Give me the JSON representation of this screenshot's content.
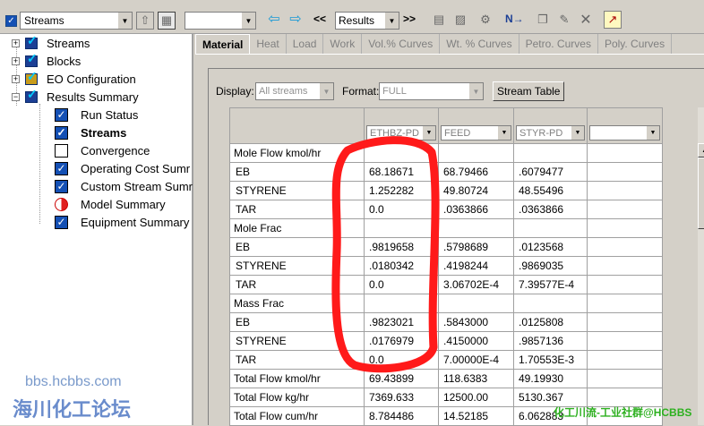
{
  "toolbar": {
    "stream_combo": "Streams",
    "nav_prev": "<<",
    "results_combo": "Results",
    "nav_next": ">>",
    "n_arrow": "N→"
  },
  "tree": {
    "top_items": [
      {
        "label": "Streams"
      },
      {
        "label": "Blocks"
      },
      {
        "label": "EO Configuration"
      },
      {
        "label": "Results Summary"
      }
    ],
    "children": [
      {
        "label": "Run Status",
        "checked": true
      },
      {
        "label": "Streams",
        "checked": true,
        "bold": true
      },
      {
        "label": "Convergence",
        "checked": false
      },
      {
        "label": "Operating Cost Sumr",
        "checked": true
      },
      {
        "label": "Custom Stream Sumr",
        "checked": true
      },
      {
        "label": "Model Summary",
        "checked": false
      },
      {
        "label": "Equipment Summary",
        "checked": true
      }
    ]
  },
  "tabs": [
    "Material",
    "Heat",
    "Load",
    "Work",
    "Vol.% Curves",
    "Wt. % Curves",
    "Petro. Curves",
    "Poly. Curves"
  ],
  "controls": {
    "display_label": "Display:",
    "display_value": "All streams",
    "format_label": "Format:",
    "format_value": "FULL",
    "stream_table_button": "Stream Table"
  },
  "grid": {
    "columns": [
      "ETHBZ-PD",
      "FEED",
      "STYR-PD",
      ""
    ],
    "rows": [
      {
        "label": "Mole Flow kmol/hr",
        "section": true,
        "values": [
          "",
          "",
          "",
          ""
        ]
      },
      {
        "label": "EB",
        "indent": true,
        "values": [
          "68.18671",
          "68.79466",
          ".6079477",
          ""
        ]
      },
      {
        "label": "STYRENE",
        "indent": true,
        "values": [
          "1.252282",
          "49.80724",
          "48.55496",
          ""
        ]
      },
      {
        "label": "TAR",
        "indent": true,
        "values": [
          "0.0",
          ".0363866",
          ".0363866",
          ""
        ]
      },
      {
        "label": "Mole Frac",
        "section": true,
        "values": [
          "",
          "",
          "",
          ""
        ]
      },
      {
        "label": "EB",
        "indent": true,
        "values": [
          ".9819658",
          ".5798689",
          ".0123568",
          ""
        ]
      },
      {
        "label": "STYRENE",
        "indent": true,
        "values": [
          ".0180342",
          ".4198244",
          ".9869035",
          ""
        ]
      },
      {
        "label": "TAR",
        "indent": true,
        "values": [
          "0.0",
          "3.06702E-4",
          "7.39577E-4",
          ""
        ]
      },
      {
        "label": "Mass Frac",
        "section": true,
        "values": [
          "",
          "",
          "",
          ""
        ]
      },
      {
        "label": "EB",
        "indent": true,
        "values": [
          ".9823021",
          ".5843000",
          ".0125808",
          ""
        ]
      },
      {
        "label": "STYRENE",
        "indent": true,
        "values": [
          ".0176979",
          ".4150000",
          ".9857136",
          ""
        ]
      },
      {
        "label": "TAR",
        "indent": true,
        "values": [
          "0.0",
          "7.00000E-4",
          "1.70553E-3",
          ""
        ]
      },
      {
        "label": "Total Flow kmol/hr",
        "section": false,
        "values": [
          "69.43899",
          "118.6383",
          "49.19930",
          ""
        ]
      },
      {
        "label": "Total Flow kg/hr",
        "section": false,
        "values": [
          "7369.633",
          "12500.00",
          "5130.367",
          ""
        ]
      },
      {
        "label": "Total Flow cum/hr",
        "section": false,
        "values": [
          "8.784486",
          "14.52185",
          "6.062883",
          ""
        ]
      }
    ]
  },
  "watermarks": {
    "site": "bbs.hcbbs.com",
    "forum_cn": "海川化工论坛",
    "credit": "化工川流-工业社群@HCBBS"
  },
  "colors": {
    "highlight_circle": "#ff1a1a",
    "checkbox": "#1450b4"
  }
}
